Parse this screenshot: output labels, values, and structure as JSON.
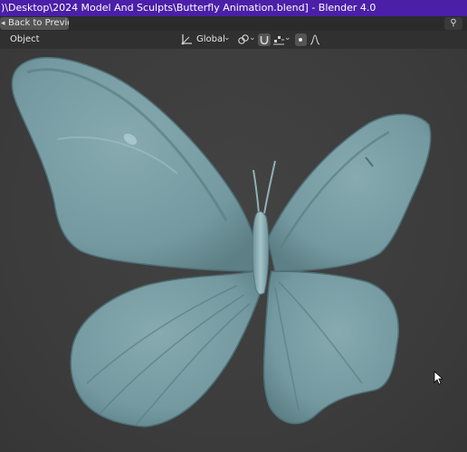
{
  "window": {
    "title": ")\\Desktop\\2024 Model And Sculpts\\Butterfly Animation.blend] - Blender 4.0"
  },
  "topbar": {
    "back_label": "Back to Previous",
    "back_icon": "back-arrow-icon",
    "scene_icon": "scene-icon"
  },
  "header": {
    "mode": "Object",
    "orientation": "Global"
  },
  "viewport": {
    "object_name": "butterfly",
    "object_color": "#7ea3a8",
    "background_color": "#3d3d3d"
  },
  "colors": {
    "titlebar": "#4b1fa8",
    "header": "#303030",
    "button": "#545454"
  }
}
